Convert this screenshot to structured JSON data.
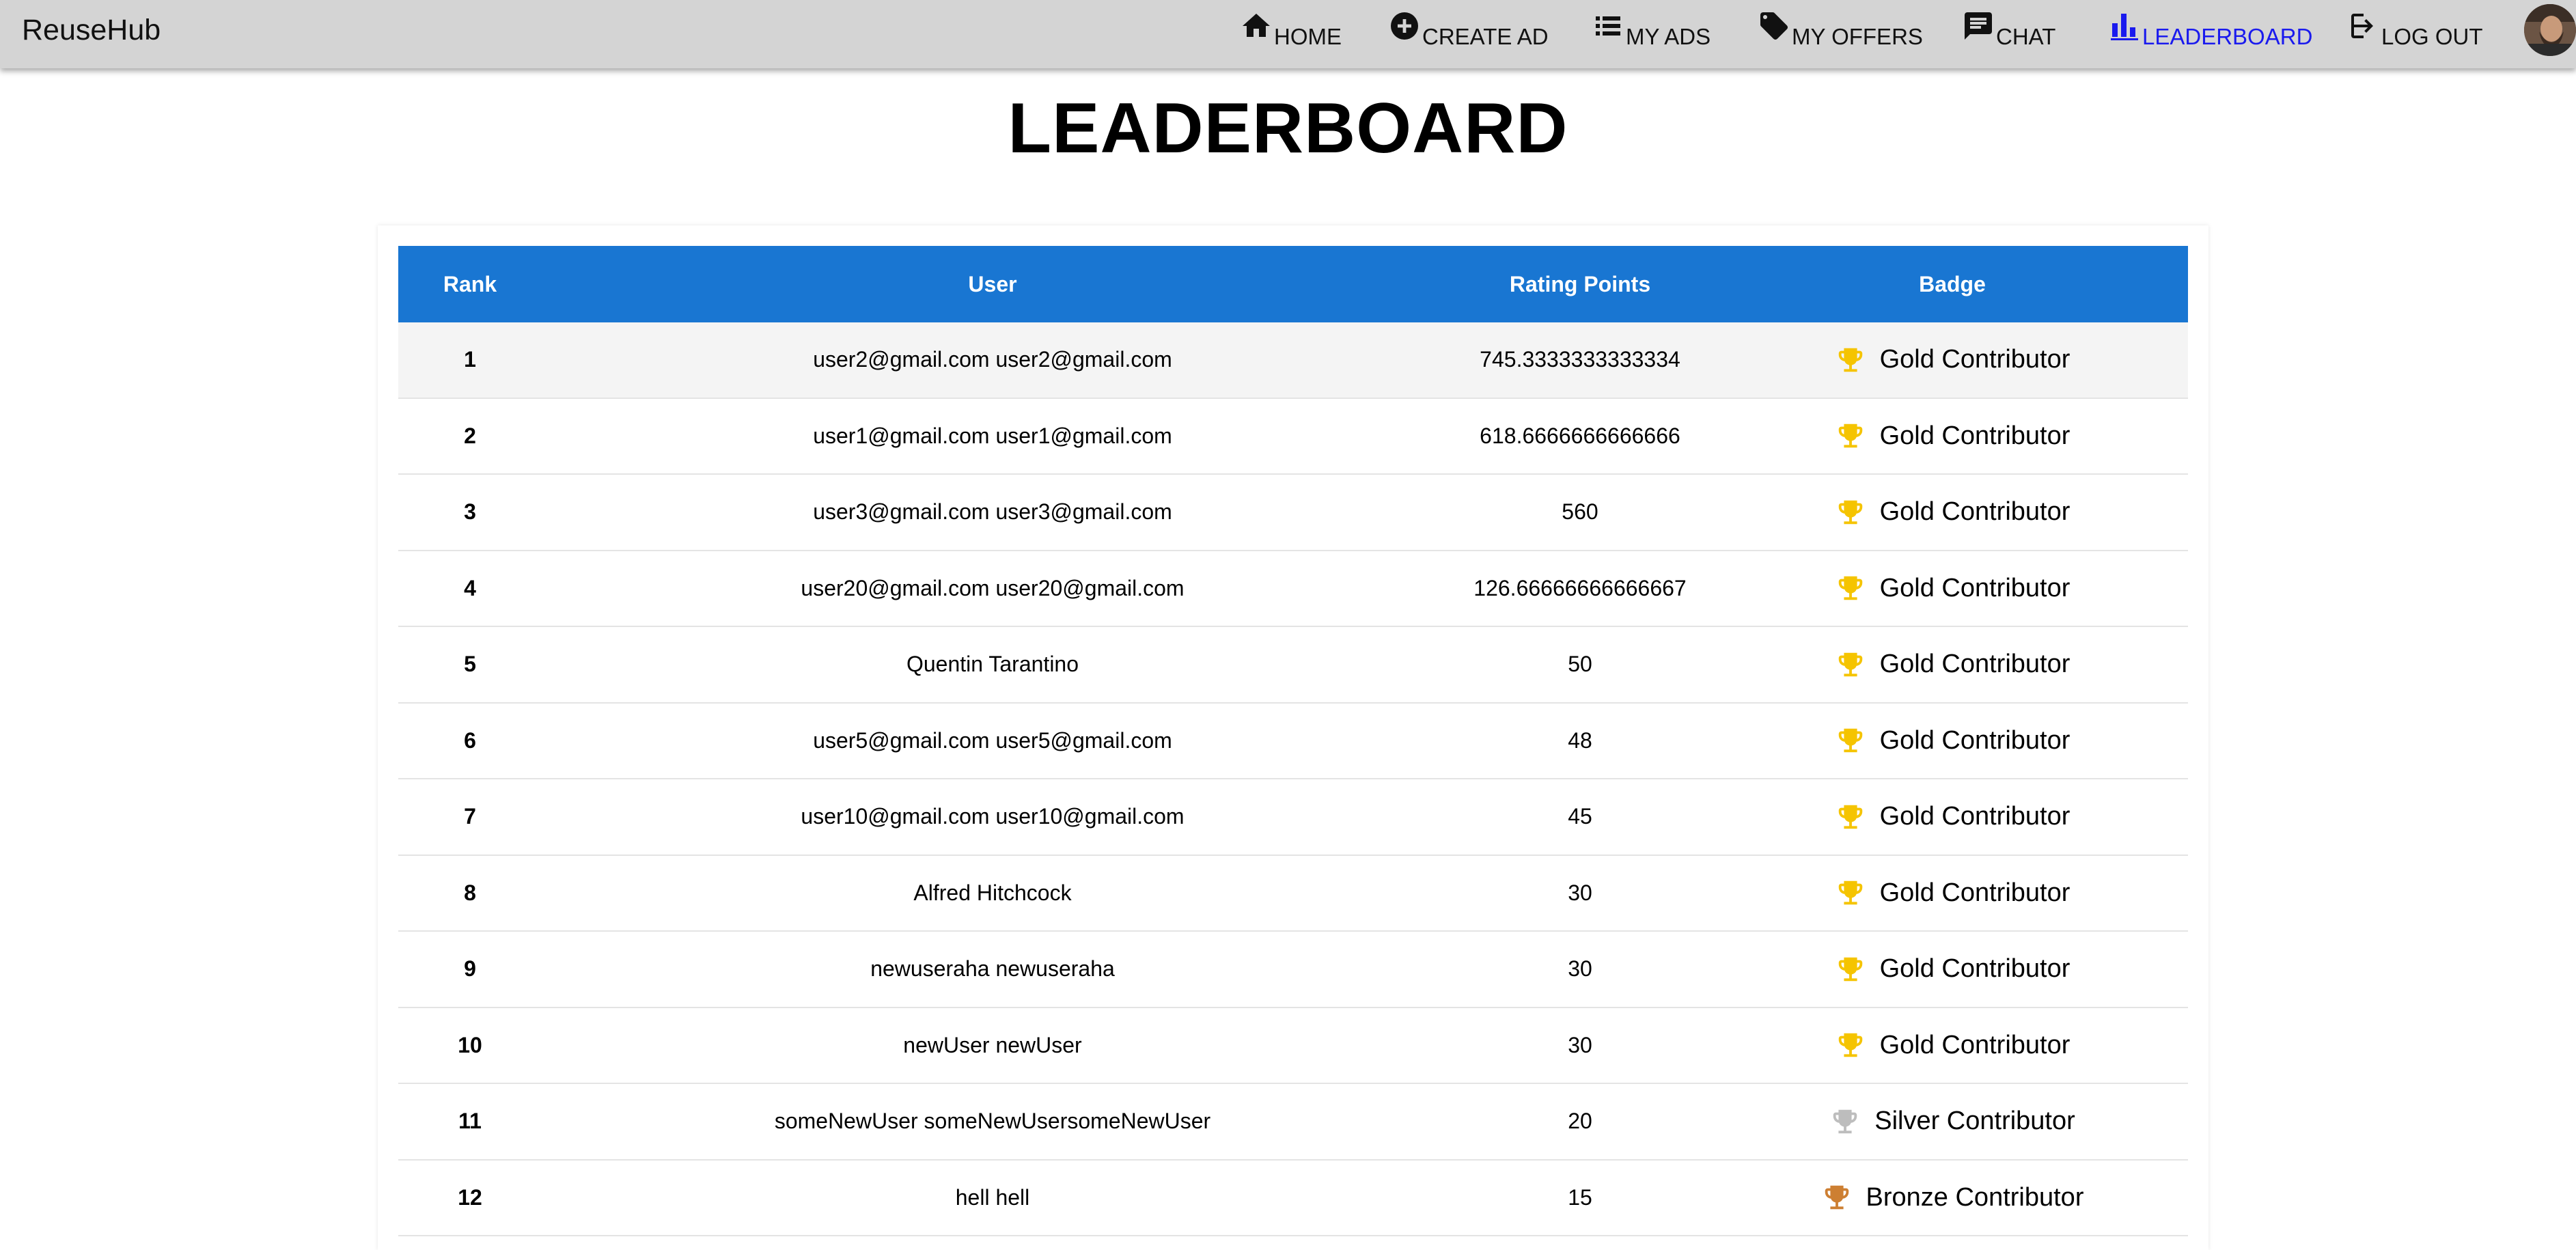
{
  "brand": "ReuseHub",
  "nav": {
    "home": "HOME",
    "create_ad": "CREATE AD",
    "my_ads": "MY ADS",
    "my_offers": "MY OFFERS",
    "chat": "CHAT",
    "leaderboard": "LEADERBOARD",
    "log_out": "LOG OUT",
    "active": "leaderboard",
    "active_color": "#1a1aee"
  },
  "page_title": "LEADERBOARD",
  "table": {
    "header_color": "#1976d2",
    "headers": {
      "rank": "Rank",
      "user": "User",
      "points": "Rating Points",
      "badge": "Badge"
    },
    "rows": [
      {
        "rank": "1",
        "user": "user2@gmail.com user2@gmail.com",
        "points": "745.3333333333334",
        "badge": "Gold Contributor",
        "tier": "gold"
      },
      {
        "rank": "2",
        "user": "user1@gmail.com user1@gmail.com",
        "points": "618.6666666666666",
        "badge": "Gold Contributor",
        "tier": "gold"
      },
      {
        "rank": "3",
        "user": "user3@gmail.com user3@gmail.com",
        "points": "560",
        "badge": "Gold Contributor",
        "tier": "gold"
      },
      {
        "rank": "4",
        "user": "user20@gmail.com user20@gmail.com",
        "points": "126.66666666666667",
        "badge": "Gold Contributor",
        "tier": "gold"
      },
      {
        "rank": "5",
        "user": "Quentin Tarantino",
        "points": "50",
        "badge": "Gold Contributor",
        "tier": "gold"
      },
      {
        "rank": "6",
        "user": "user5@gmail.com user5@gmail.com",
        "points": "48",
        "badge": "Gold Contributor",
        "tier": "gold"
      },
      {
        "rank": "7",
        "user": "user10@gmail.com user10@gmail.com",
        "points": "45",
        "badge": "Gold Contributor",
        "tier": "gold"
      },
      {
        "rank": "8",
        "user": "Alfred Hitchcock",
        "points": "30",
        "badge": "Gold Contributor",
        "tier": "gold"
      },
      {
        "rank": "9",
        "user": "newuseraha newuseraha",
        "points": "30",
        "badge": "Gold Contributor",
        "tier": "gold"
      },
      {
        "rank": "10",
        "user": "newUser newUser",
        "points": "30",
        "badge": "Gold Contributor",
        "tier": "gold"
      },
      {
        "rank": "11",
        "user": "someNewUser someNewUsersomeNewUser",
        "points": "20",
        "badge": "Silver Contributor",
        "tier": "silver"
      },
      {
        "rank": "12",
        "user": "hell hell",
        "points": "15",
        "badge": "Bronze Contributor",
        "tier": "bronze"
      }
    ],
    "tier_colors": {
      "gold": "#f5c400",
      "silver": "#bdbdbd",
      "bronze": "#cd7f32"
    }
  }
}
